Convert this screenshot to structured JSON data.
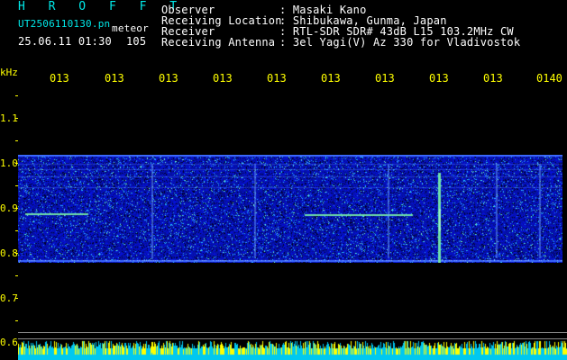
{
  "header": {
    "program": "H R O F F T",
    "filename": "UT2506110130.pn",
    "mode": "meteor",
    "date_time": "25.06.11 01:30",
    "count": "105",
    "fields": [
      {
        "label": "Observer",
        "value": ": Masaki Kano"
      },
      {
        "label": "Receiving Location",
        "value": ": Shibukawa, Gunma, Japan"
      },
      {
        "label": "Receiver",
        "value": ": RTL-SDR SDR# 43dB L15 103.2MHz CW"
      },
      {
        "label": "Receiving Antenna",
        "value": ": 3el Yagi(V) Az 330 for Vladivostok"
      }
    ]
  },
  "axis": {
    "unit": "kHz",
    "time_ticks": [
      "013",
      "013",
      "013",
      "013",
      "013",
      "013",
      "013",
      "013",
      "013",
      "0140"
    ],
    "freq_ticks": [
      "1.1",
      "1.0",
      "0.9",
      "0.8",
      "0.7",
      "0.6"
    ]
  },
  "colors": {
    "text_cyan": "#00e8e8",
    "text_white": "#ffffff",
    "axis_yellow": "#ffff00",
    "spectrum_blue": "#0a1fd0",
    "noise_bar_cyan": "#00c8f0"
  }
}
